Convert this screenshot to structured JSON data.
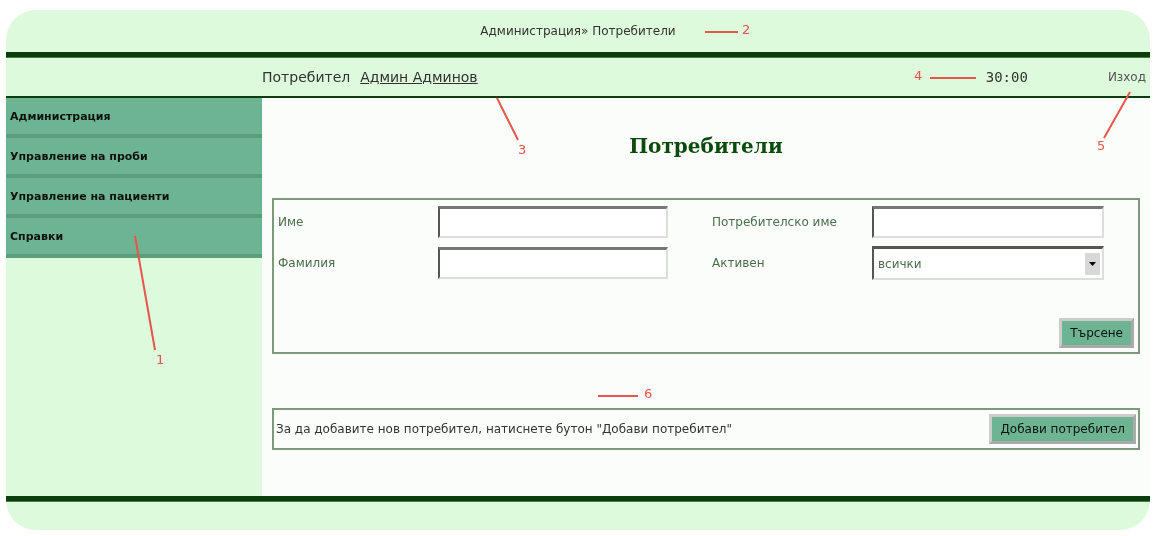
{
  "breadcrumb": "Администрация» Потребители",
  "user_bar": {
    "label": "Потребител",
    "user": "Админ Админов",
    "timer": "30:00",
    "logout": "Изход"
  },
  "sidebar": {
    "items": [
      {
        "label": "Администрация",
        "selected": false
      },
      {
        "label": "Управление на проби",
        "selected": false
      },
      {
        "label": "Управление на пациенти",
        "selected": false
      },
      {
        "label": "Справки",
        "selected": false
      }
    ]
  },
  "page_title": "Потребители",
  "search_form": {
    "fields": [
      {
        "label": "Име",
        "kind": "text"
      },
      {
        "label": "Потребителско име",
        "kind": "text"
      },
      {
        "label": "Фамилия",
        "kind": "text"
      },
      {
        "label": "Активен",
        "kind": "select",
        "value": "всички"
      }
    ],
    "button": "Търсене"
  },
  "add_panel": {
    "text": "За да добавите нов потребител, натиснете бутон \"Добави потребител\"",
    "button": "Добави потребител"
  },
  "annotations": [
    "1",
    "2",
    "3",
    "4",
    "5",
    "6"
  ]
}
